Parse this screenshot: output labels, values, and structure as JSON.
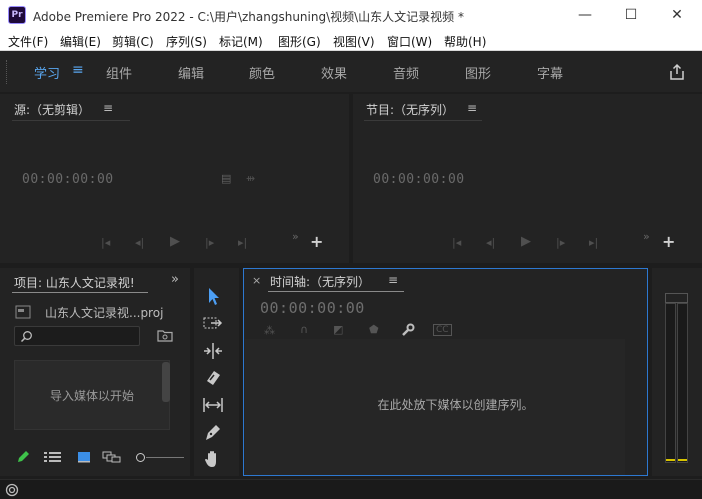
{
  "titlebar": {
    "app_icon": "Pr",
    "title": "Adobe Premiere Pro 2022 - C:\\用户\\zhangshuning\\视频\\山东人文记录视频 *",
    "minimize": "—",
    "maximize": "☐",
    "close": "✕"
  },
  "menu": [
    {
      "label": "文件(F)"
    },
    {
      "label": "编辑(E)"
    },
    {
      "label": "剪辑(C)"
    },
    {
      "label": "序列(S)"
    },
    {
      "label": "标记(M)"
    },
    {
      "label": "图形(G)"
    },
    {
      "label": "视图(V)"
    },
    {
      "label": "窗口(W)"
    },
    {
      "label": "帮助(H)"
    }
  ],
  "workspaces": {
    "active": "学习",
    "menu_icon": "≡",
    "items": [
      {
        "label": "组件"
      },
      {
        "label": "编辑"
      },
      {
        "label": "颜色"
      },
      {
        "label": "效果"
      },
      {
        "label": "音频"
      },
      {
        "label": "图形"
      },
      {
        "label": "字幕"
      }
    ]
  },
  "source": {
    "title": "源:（无剪辑）",
    "menu": "≡",
    "timecode": "00:00:00:00"
  },
  "program": {
    "title": "节目:（无序列）",
    "menu": "≡",
    "timecode": "00:00:00:00"
  },
  "controls": {
    "plus": "+",
    "more": "»"
  },
  "project": {
    "title": "项目: 山东人文记录视!",
    "expand": "»",
    "file": "山东人文记录视...proj",
    "search_placeholder": "",
    "import_hint": "导入媒体以开始"
  },
  "timeline": {
    "close": "×",
    "title": "时间轴:（无序列）",
    "menu": "≡",
    "timecode": "00:00:00:00",
    "empty_hint": "在此处放下媒体以创建序列。"
  },
  "colors": {
    "accent": "#4c9ef3",
    "timeline_border": "#2d78d0"
  }
}
